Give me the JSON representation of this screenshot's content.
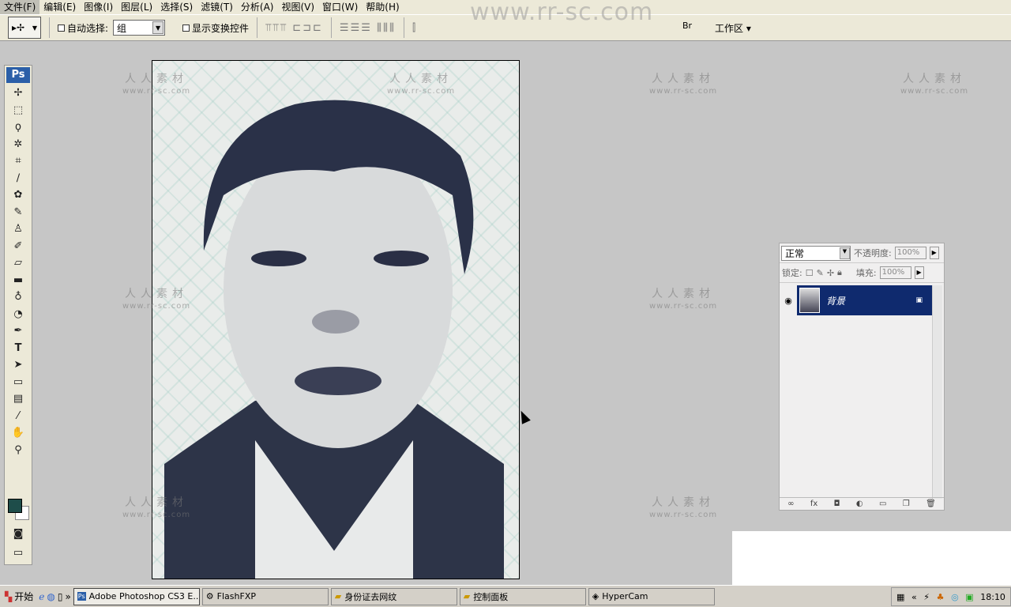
{
  "menu": [
    "文件(F)",
    "编辑(E)",
    "图像(I)",
    "图层(L)",
    "选择(S)",
    "滤镜(T)",
    "分析(A)",
    "视图(V)",
    "窗口(W)",
    "帮助(H)"
  ],
  "options": {
    "auto_select_label": "自动选择:",
    "auto_select_value": "组",
    "show_transform_label": "显示变换控件",
    "workspace_label": "工作区 ▾"
  },
  "toolbox": {
    "logo": "Ps",
    "tools": [
      "move",
      "marquee",
      "lasso",
      "magic-wand",
      "crop",
      "slice",
      "healing",
      "brush",
      "stamp",
      "history-brush",
      "eraser",
      "gradient",
      "blur",
      "dodge",
      "pen",
      "type",
      "path-select",
      "shape",
      "notes",
      "eyedropper",
      "hand",
      "zoom"
    ],
    "foreground_color": "#1e4d4a",
    "background_color": "#ffffff"
  },
  "layers": {
    "blend_mode": "正常",
    "opacity_label": "不透明度:",
    "opacity_value": "100%",
    "lock_label": "锁定:",
    "fill_label": "填充:",
    "fill_value": "100%",
    "items": [
      {
        "name": "背景",
        "locked": true,
        "visible": true
      }
    ]
  },
  "taskbar": {
    "start": "开始",
    "tasks": [
      "Adobe Photoshop CS3 E...",
      "FlashFXP",
      "身份证去网纹",
      "控制面板",
      "HyperCam"
    ],
    "clock": "18:10"
  },
  "watermark": {
    "cn": "人人素材",
    "url": "www.rr-sc.com",
    "top": "www.rr-sc.com"
  }
}
